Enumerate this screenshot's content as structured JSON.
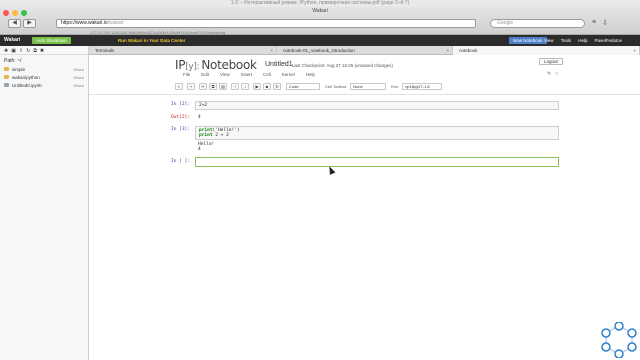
{
  "os": {
    "title": "1-2 -- Интерактивный режим, IPython, примерочная системы.pdf (page 2 of 7)"
  },
  "browser": {
    "window_title": "Wakari",
    "url_host": "https://www.wakari.io",
    "url_rest": "/wakari",
    "search_placeholder": "Google",
    "status_url": "172.31.203.108/1381:8d60f69c6d21/a2b5e11f9c9ff1b1c3cad7f7f1/notesblog"
  },
  "wakari": {
    "logo": "Wakari",
    "auto_shutdown": "Auto Shutdown",
    "run_banner": "Run Wakari in Your Data Center",
    "new_notebook": "New Notebook",
    "menu": [
      "View",
      "Tools",
      "Help",
      "PavelFedotov"
    ]
  },
  "sidebar": {
    "path_label": "Path: ~/",
    "items": [
      {
        "name": "simple",
        "action": "Share",
        "type": "folder"
      },
      {
        "name": "wakari/python",
        "action": "Share",
        "type": "folder"
      },
      {
        "name": "Untitled0.ipynb",
        "action": "Share",
        "type": "notebook"
      }
    ]
  },
  "tabs": [
    {
      "label": "Terminals"
    },
    {
      "label": "notebook-01_notebook_introduction"
    },
    {
      "label": "notebook"
    }
  ],
  "notebook": {
    "logo_main": "IP",
    "logo_bracket": "[y]:",
    "logo_word": "Notebook",
    "title": "Untitled1",
    "checkpoint": "Last Checkpoint: Aug 27 16:25 (unsaved changes)",
    "logout": "Logout",
    "menu": [
      "File",
      "Edit",
      "View",
      "Insert",
      "Cell",
      "Kernel",
      "Help"
    ],
    "toolbar": {
      "cell_type": "Code",
      "cell_toolbar_label": "Cell Toolbar:",
      "cell_toolbar_value": "None",
      "env_label": "Env:",
      "env_value": "np18py27-1.8"
    }
  },
  "cells": {
    "c1": {
      "prompt": "In [2]:",
      "code": "2+2"
    },
    "o1": {
      "prompt": "Out[2]:",
      "text": "4"
    },
    "c2": {
      "prompt": "In [3]:",
      "line1_kw": "print",
      "line1_rest": "('Hello!')",
      "line2_kw": "print",
      "line2_rest": " 2 + 2"
    },
    "o2": {
      "line1": "Hello!",
      "line2": "4"
    },
    "c3": {
      "prompt": "In [ ]:"
    }
  }
}
